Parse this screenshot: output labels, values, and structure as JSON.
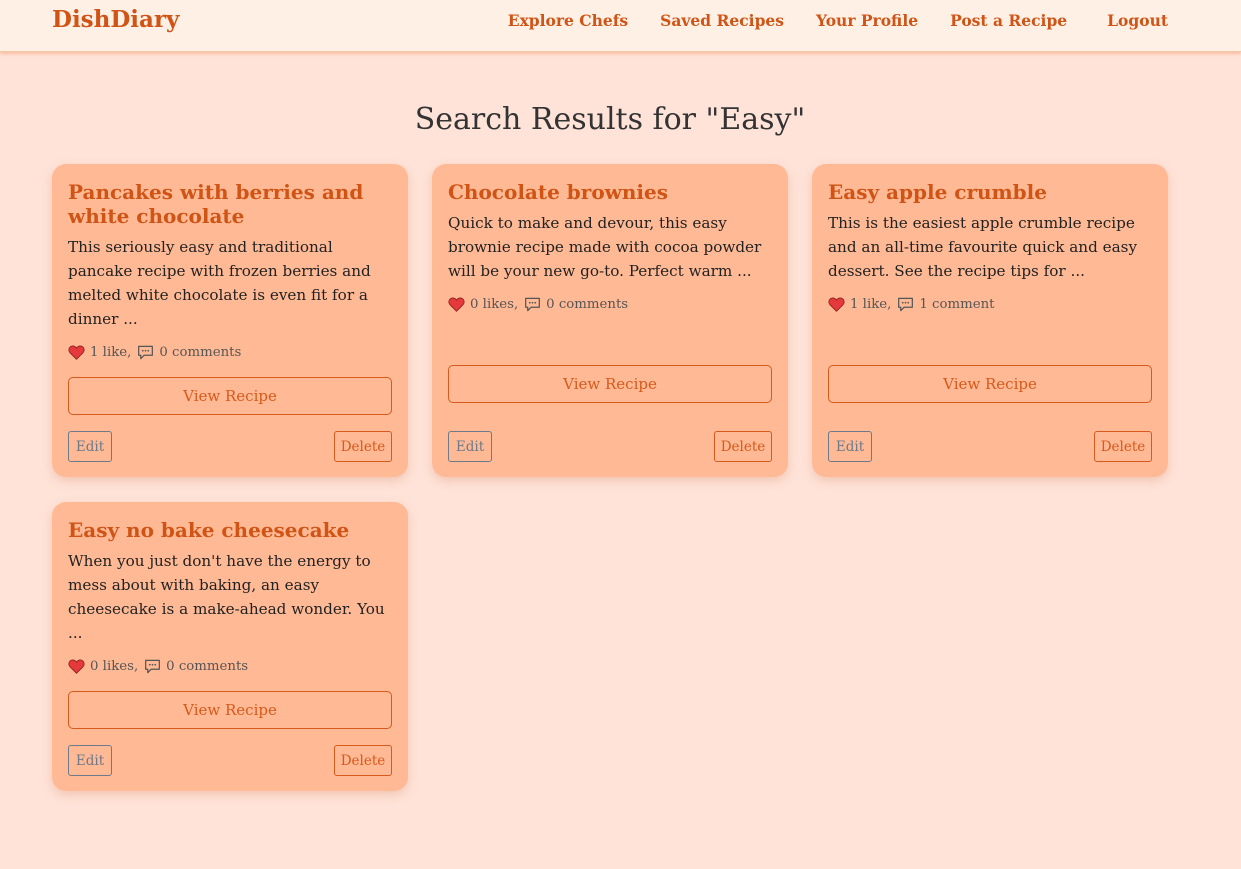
{
  "navbar": {
    "brand": "DishDiary",
    "links": [
      "Explore Chefs",
      "Saved Recipes",
      "Your Profile",
      "Post a Recipe",
      "Logout"
    ]
  },
  "page": {
    "title": "Search Results for \"Easy\""
  },
  "recipes": [
    {
      "title": "Pancakes with berries and white chocolate",
      "description": "This seriously easy and traditional pancake recipe with frozen berries and melted white chocolate is even fit for a dinner ...",
      "likes": "1 like,",
      "comments": "0 comments",
      "view_label": "View Recipe",
      "edit_label": "Edit",
      "delete_label": "Delete"
    },
    {
      "title": "Chocolate brownies",
      "description": "Quick to make and devour, this easy brownie recipe made with cocoa powder will be your new go-to. Perfect warm ...",
      "likes": "0 likes,",
      "comments": "0 comments",
      "view_label": "View Recipe",
      "edit_label": "Edit",
      "delete_label": "Delete"
    },
    {
      "title": "Easy apple crumble",
      "description": "This is the easiest apple crumble recipe and an all-time favourite quick and easy dessert. See the recipe tips for ...",
      "likes": "1 like,",
      "comments": "1 comment",
      "view_label": "View Recipe",
      "edit_label": "Edit",
      "delete_label": "Delete"
    },
    {
      "title": "Easy no bake cheesecake",
      "description": "When you just don't have the energy to mess about with baking, an easy cheesecake is a make-ahead wonder. You ...",
      "likes": "0 likes,",
      "comments": "0 comments",
      "view_label": "View Recipe",
      "edit_label": "Edit",
      "delete_label": "Delete"
    }
  ],
  "icons": {
    "like": "heart-icon",
    "comment": "comment-icon"
  },
  "colors": {
    "accent": "#cf5415",
    "card_bg": "#ffb994",
    "page_bg": "#ffe3d8",
    "nav_bg": "#fff0e6",
    "heart": "#e5393b"
  }
}
